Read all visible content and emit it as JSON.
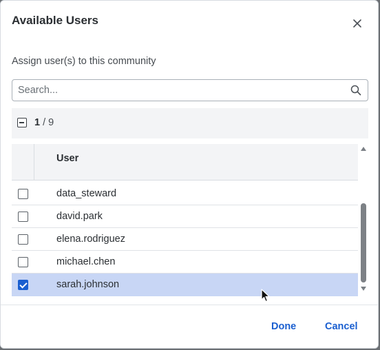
{
  "dialog": {
    "title": "Available Users",
    "subtitle": "Assign user(s) to this community"
  },
  "search": {
    "placeholder": "Search...",
    "value": ""
  },
  "selection": {
    "selected": "1",
    "total": "/ 9"
  },
  "table": {
    "columns": [
      "User"
    ],
    "rows": [
      {
        "user": "data_steward",
        "checked": false
      },
      {
        "user": "david.park",
        "checked": false
      },
      {
        "user": "elena.rodriguez",
        "checked": false
      },
      {
        "user": "michael.chen",
        "checked": false
      },
      {
        "user": "sarah.johnson",
        "checked": true
      }
    ]
  },
  "footer": {
    "done_label": "Done",
    "cancel_label": "Cancel"
  },
  "colors": {
    "accent": "#1a5fd0",
    "selected_row": "#c8d6f5"
  },
  "icons": {
    "close": "close-icon",
    "search": "search-icon",
    "cursor": "mouse-pointer-icon"
  }
}
